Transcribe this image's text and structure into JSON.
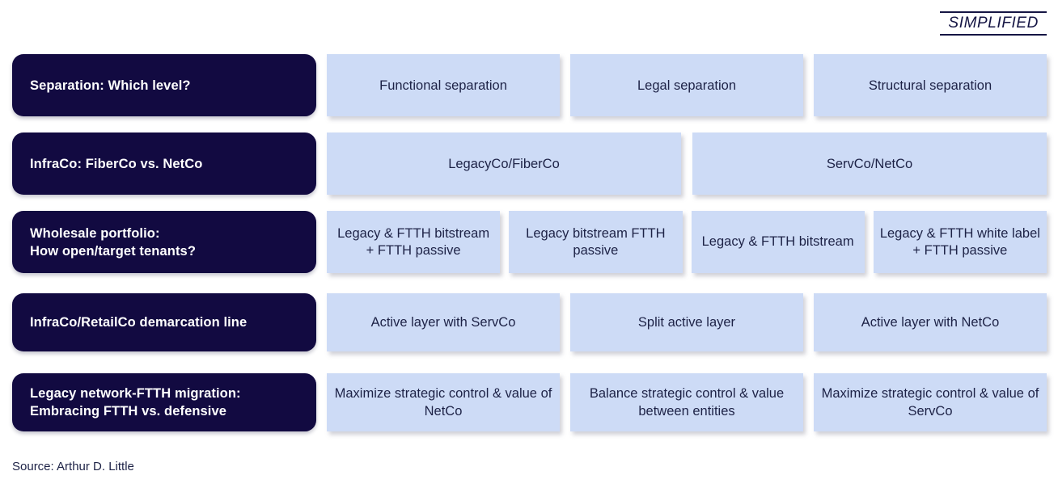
{
  "banner": {
    "label": "SIMPLIFIED"
  },
  "colors": {
    "dark_navy": "#120A41",
    "light_blue": "#CDDBF6",
    "text_navy": "#1D2246",
    "white": "#FFFFFF"
  },
  "rows": [
    {
      "label": "Separation: Which level?",
      "label_lines": [
        "Separation: Which level?"
      ],
      "cells": [
        "Functional separation",
        "Legal separation",
        "Structural separation"
      ]
    },
    {
      "label": "InfraCo: FiberCo vs. NetCo",
      "label_lines": [
        "InfraCo: FiberCo vs. NetCo"
      ],
      "cells": [
        "LegacyCo/FiberCo",
        "ServCo/NetCo"
      ]
    },
    {
      "label": "Wholesale portfolio: How open/target tenants?",
      "label_lines": [
        "Wholesale portfolio:",
        "How open/target tenants?"
      ],
      "cells": [
        "Legacy & FTTH bitstream + FTTH passive",
        "Legacy bitstream FTTH passive",
        "Legacy & FTTH bitstream",
        "Legacy & FTTH white label + FTTH passive"
      ]
    },
    {
      "label": "InfraCo/RetailCo demarcation line",
      "label_lines": [
        "InfraCo/RetailCo demarcation line"
      ],
      "cells": [
        "Active layer with ServCo",
        "Split active layer",
        "Active layer with NetCo"
      ]
    },
    {
      "label": "Legacy network-FTTH migration: Embracing FTTH vs. defensive",
      "label_lines": [
        "Legacy network-FTTH migration:",
        "Embracing FTTH vs. defensive"
      ],
      "cells": [
        "Maximize strategic control & value of NetCo",
        "Balance strategic control & value between entities",
        "Maximize strategic control & value of ServCo"
      ]
    }
  ],
  "footer": {
    "source": "Source: Arthur D. Little"
  }
}
